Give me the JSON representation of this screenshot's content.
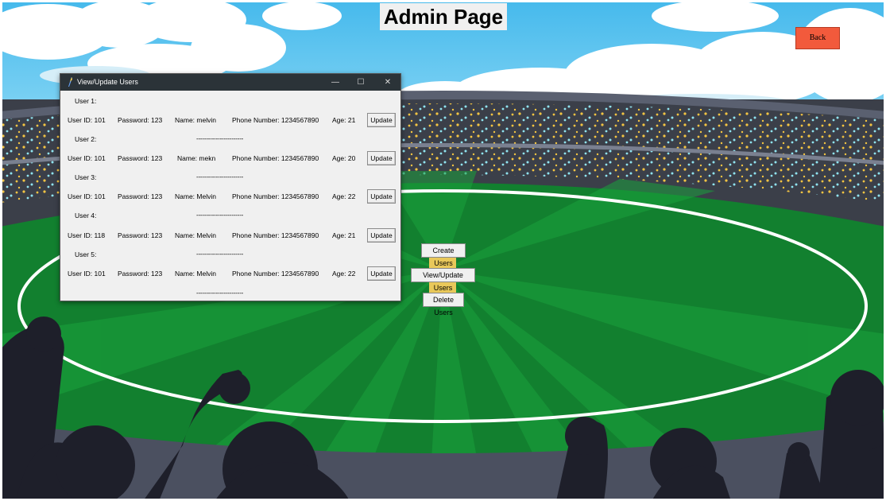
{
  "page": {
    "title": "Admin Page",
    "back_label": "Back"
  },
  "menu": {
    "create": "Create Users",
    "view": "View/Update Users",
    "delete": "Delete Users"
  },
  "window": {
    "title": "View/Update Users",
    "minimize": "—",
    "maximize": "☐",
    "close": "✕"
  },
  "users": [
    {
      "header": "User 1:",
      "id": "User ID: 101",
      "password": "Password: 123",
      "name": "Name: melvin",
      "phone": "Phone Number: 1234567890",
      "age": "Age: 21",
      "update": "Update",
      "separator": "------------------------"
    },
    {
      "header": "User 2:",
      "id": "User ID: 101",
      "password": "Password: 123",
      "name": "Name: mekn",
      "phone": "Phone Number: 1234567890",
      "age": "Age: 20",
      "update": "Update",
      "separator": "------------------------"
    },
    {
      "header": "User 3:",
      "id": "User ID: 101",
      "password": "Password: 123",
      "name": "Name: Melvin",
      "phone": "Phone Number: 1234567890",
      "age": "Age: 22",
      "update": "Update",
      "separator": "------------------------"
    },
    {
      "header": "User 4:",
      "id": "User ID: 118",
      "password": "Password: 123",
      "name": "Name: Melvin",
      "phone": "Phone Number: 1234567890",
      "age": "Age: 21",
      "update": "Update",
      "separator": "------------------------"
    },
    {
      "header": "User 5:",
      "id": "User ID: 101",
      "password": "Password: 123",
      "name": "Name: Melvin",
      "phone": "Phone Number: 1234567890",
      "age": "Age: 22",
      "update": "Update",
      "separator": "------------------------"
    }
  ],
  "colors": {
    "sky": "#5cc6ef",
    "field": "#1b9a36",
    "back_button": "#f25a3c",
    "titlebar": "#2b3338"
  }
}
